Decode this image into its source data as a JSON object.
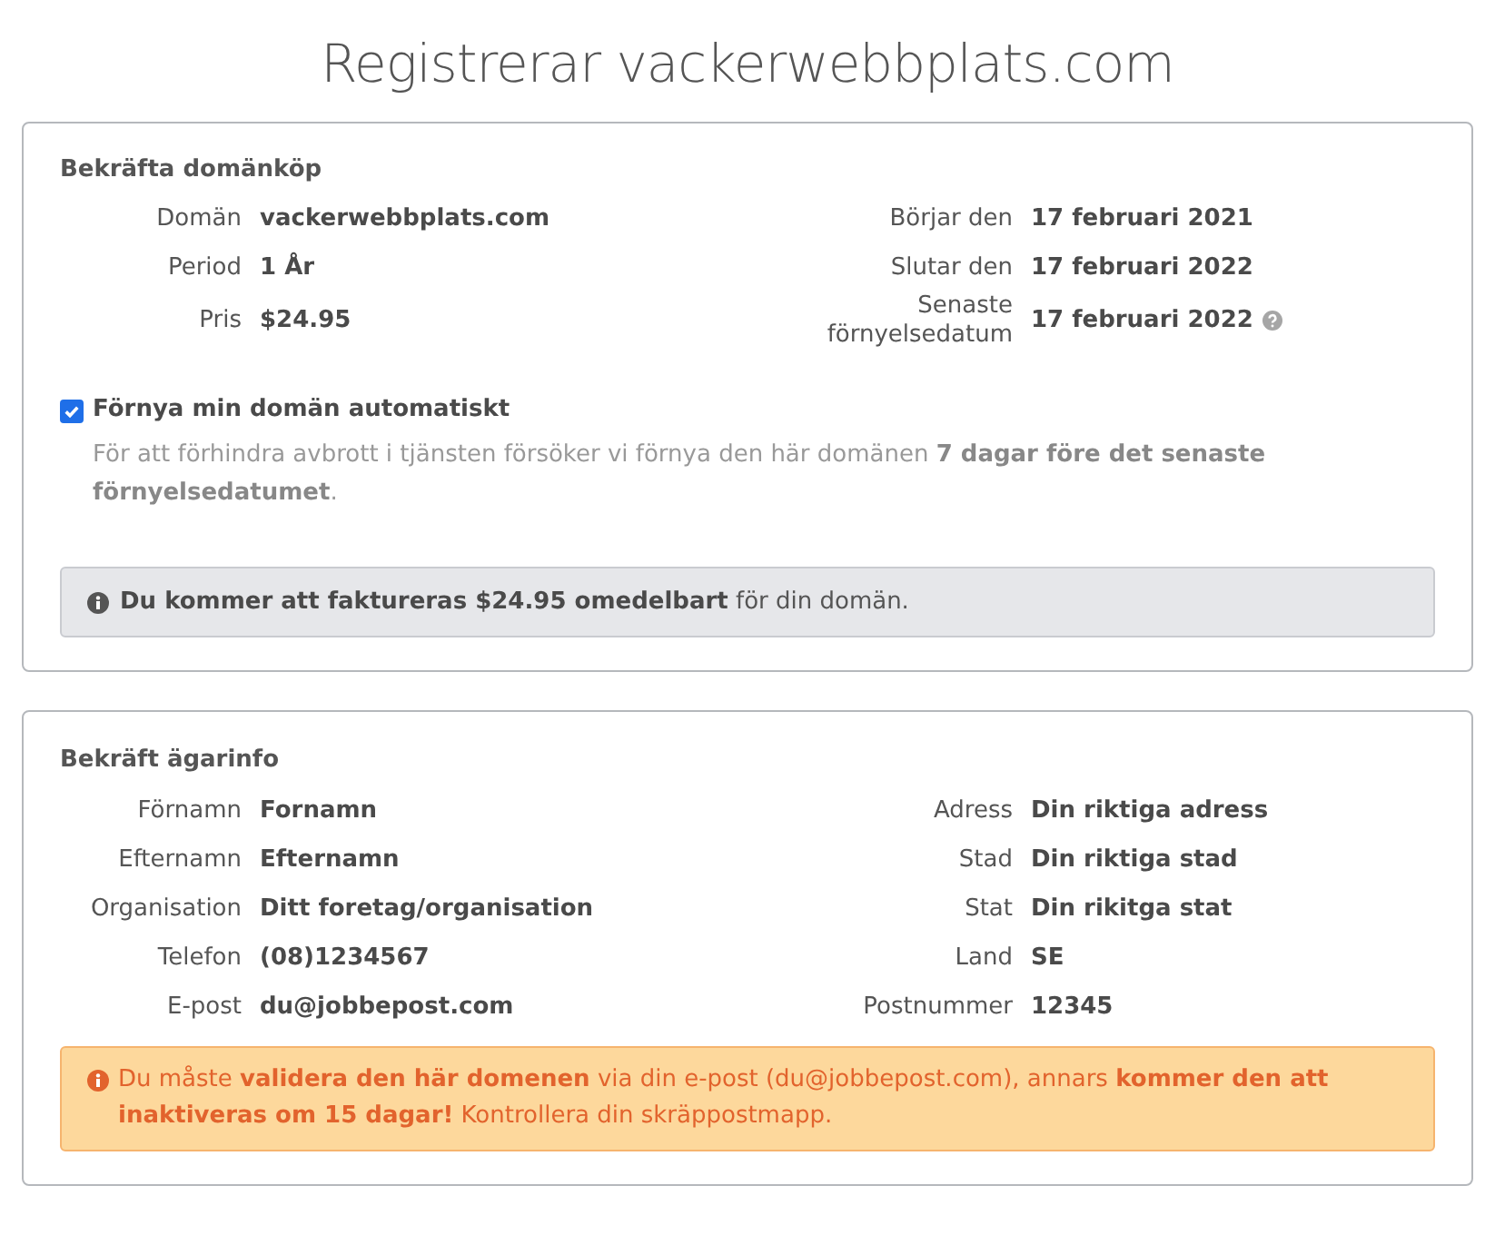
{
  "title": "Registrerar vackerwebbplats.com",
  "purchase": {
    "heading": "Bekräfta domänköp",
    "rows": [
      {
        "left": {
          "label": "Domän",
          "value": "vackerwebbplats.com"
        },
        "right": {
          "label": "Börjar den",
          "value": "17 februari 2021",
          "help": false
        }
      },
      {
        "left": {
          "label": "Period",
          "value": "1 År"
        },
        "right": {
          "label": "Slutar den",
          "value": "17 februari 2022",
          "help": false
        }
      },
      {
        "left": {
          "label": "Pris",
          "value": "$24.95"
        },
        "right": {
          "label": "Senaste förnyelsedatum",
          "value": "17 februari 2022",
          "help": true
        }
      }
    ],
    "auto_renew": {
      "label": "Förnya min domän automatiskt",
      "checked": true,
      "note": "För att förhindra avbrott i tjänsten försöker vi förnya den här domänen **7 dagar före det senaste förnyelsedatumet**."
    },
    "notice": "**Du kommer att faktureras $24.95 omedelbart** för din domän."
  },
  "owner": {
    "heading": "Bekräft ägarinfo",
    "rows": [
      {
        "left": {
          "label": "Förnamn",
          "value": "Fornamn"
        },
        "right": {
          "label": "Adress",
          "value": "Din riktiga adress",
          "help": false
        }
      },
      {
        "left": {
          "label": "Efternamn",
          "value": "Efternamn"
        },
        "right": {
          "label": "Stad",
          "value": "Din riktiga stad",
          "help": false
        }
      },
      {
        "left": {
          "label": "Organisation",
          "value": "Ditt foretag/organisation"
        },
        "right": {
          "label": "Stat",
          "value": "Din rikitga stat",
          "help": false
        }
      },
      {
        "left": {
          "label": "Telefon",
          "value": "(08)1234567"
        },
        "right": {
          "label": "Land",
          "value": "SE",
          "help": false
        }
      },
      {
        "left": {
          "label": "E-post",
          "value": "du@jobbepost.com"
        },
        "right": {
          "label": "Postnummer",
          "value": "12345",
          "help": false
        }
      }
    ],
    "warning": "Du måste **validera den här domenen** via din e-post (du@jobbepost.com), annars **kommer den att inaktiveras om 15 dagar!** Kontrollera din skräppostmapp."
  }
}
